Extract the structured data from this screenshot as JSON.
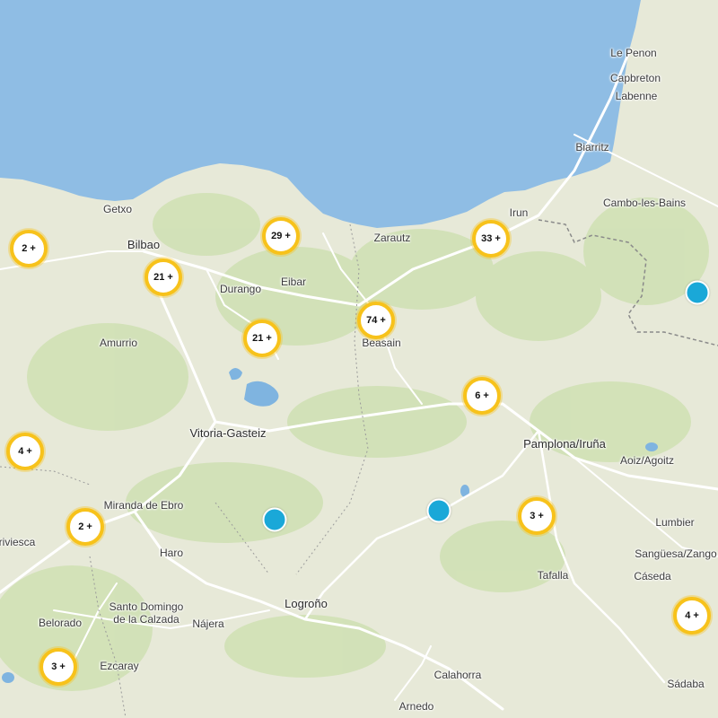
{
  "colors": {
    "sea": "#8fbde4",
    "land": "#e7e9d8",
    "forest": "#c9dcae",
    "road": "#ffffff",
    "water_body": "#7fb4e0",
    "cluster_ring": "#f7c21b",
    "marker_fill": "#1aa8d8"
  },
  "places": [
    {
      "id": "le-penon",
      "label": "Le Penon"
    },
    {
      "id": "capbreton",
      "label": "Capbreton"
    },
    {
      "id": "labenne",
      "label": "Labenne"
    },
    {
      "id": "biarritz",
      "label": "Biarritz"
    },
    {
      "id": "cambo-les-bains",
      "label": "Cambo-les-Bains"
    },
    {
      "id": "getxo",
      "label": "Getxo"
    },
    {
      "id": "irun",
      "label": "Irun"
    },
    {
      "id": "bilbao",
      "label": "Bilbao"
    },
    {
      "id": "zarautz",
      "label": "Zarautz"
    },
    {
      "id": "durango",
      "label": "Durango"
    },
    {
      "id": "eibar",
      "label": "Eibar"
    },
    {
      "id": "amurrio",
      "label": "Amurrio"
    },
    {
      "id": "beasain",
      "label": "Beasain"
    },
    {
      "id": "vitoria-gasteiz",
      "label": "Vitoria-Gasteiz"
    },
    {
      "id": "pamplona-iruna",
      "label": "Pamplona/Iruña"
    },
    {
      "id": "aoiz-agoitz",
      "label": "Aoiz/Agoitz"
    },
    {
      "id": "miranda-de-ebro",
      "label": "Miranda de Ebro"
    },
    {
      "id": "briviesca",
      "label": "riviesca"
    },
    {
      "id": "haro",
      "label": "Haro"
    },
    {
      "id": "lumbier",
      "label": "Lumbier"
    },
    {
      "id": "sanguesa",
      "label": "Sangüesa/Zango"
    },
    {
      "id": "tafalla",
      "label": "Tafalla"
    },
    {
      "id": "caseda",
      "label": "Cáseda"
    },
    {
      "id": "santo-domingo-1",
      "label": "Santo Domingo"
    },
    {
      "id": "santo-domingo-2",
      "label": "de la Calzada"
    },
    {
      "id": "logrono",
      "label": "Logroño"
    },
    {
      "id": "belorado",
      "label": "Belorado"
    },
    {
      "id": "najera",
      "label": "Nájera"
    },
    {
      "id": "ezcaray",
      "label": "Ezcaray"
    },
    {
      "id": "calahorra",
      "label": "Calahorra"
    },
    {
      "id": "sadaba",
      "label": "Sádaba"
    },
    {
      "id": "arnedo",
      "label": "Arnedo"
    }
  ],
  "clusters": [
    {
      "id": "c1",
      "label": "2 +"
    },
    {
      "id": "c2",
      "label": "29 +"
    },
    {
      "id": "c3",
      "label": "33 +"
    },
    {
      "id": "c4",
      "label": "21 +"
    },
    {
      "id": "c5",
      "label": "74 +"
    },
    {
      "id": "c6",
      "label": "21 +"
    },
    {
      "id": "c7",
      "label": "6 +"
    },
    {
      "id": "c8",
      "label": "4 +"
    },
    {
      "id": "c9",
      "label": "2 +"
    },
    {
      "id": "c10",
      "label": "3 +"
    },
    {
      "id": "c11",
      "label": "4 +"
    },
    {
      "id": "c12",
      "label": "3 +"
    }
  ],
  "markers": [
    {
      "id": "m1"
    },
    {
      "id": "m2"
    },
    {
      "id": "m3"
    }
  ]
}
